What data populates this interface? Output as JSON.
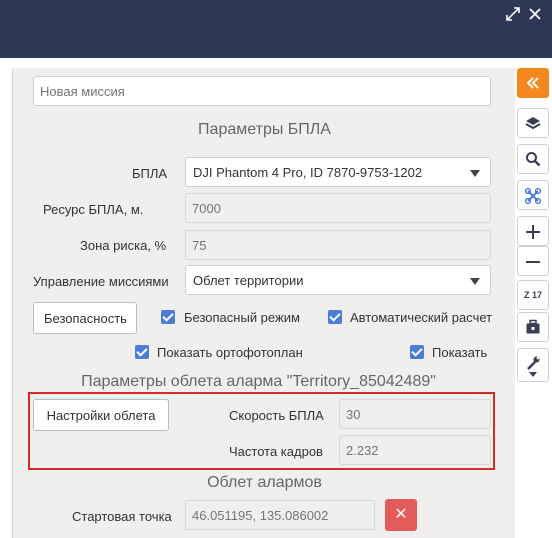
{
  "window": {
    "icons": [
      "expand-icon",
      "close-icon"
    ],
    "colors": {
      "titlebar": "#2e3756",
      "accent": "#f5871f",
      "checkbox": "#4c7dd6",
      "highlight": "#d62a2a",
      "delete": "#e35b5b"
    }
  },
  "mission": {
    "name_placeholder": "Новая миссия"
  },
  "uav_params": {
    "title": "Параметры БПЛА",
    "uav_label": "БПЛА",
    "uav_value": "DJI Phantom 4 Pro, ID 7870-9753-1202",
    "resource_label": "Ресурс БПЛА, м.",
    "resource_placeholder": "7000",
    "risk_label": "Зона риска, %",
    "risk_placeholder": "75",
    "control_label": "Управление миссиями",
    "control_value": "Облет территории",
    "safety_button": "Безопасность",
    "safe_mode_label": "Безопасный режим",
    "safe_mode_checked": true,
    "auto_calc_label": "Автоматический расчет",
    "auto_calc_checked": true,
    "show_orthophoto_label": "Показать ортофотоплан",
    "show_orthophoto_checked": true,
    "show_label": "Показать",
    "show_checked": true
  },
  "alarm_flight": {
    "title": "Параметры облета аларма  \"Territory_85042489\"",
    "settings_button": "Настройки облета",
    "speed_label": "Скорость БПЛА",
    "speed_placeholder": "30",
    "frame_rate_label": "Частота кадров",
    "frame_rate_placeholder": "2.232"
  },
  "alarms": {
    "title": "Облет алармов",
    "start_label": "Стартовая точка",
    "start_placeholder": "46.051195, 135.086002"
  },
  "toolbar": {
    "zoom_level": "Z 17"
  }
}
